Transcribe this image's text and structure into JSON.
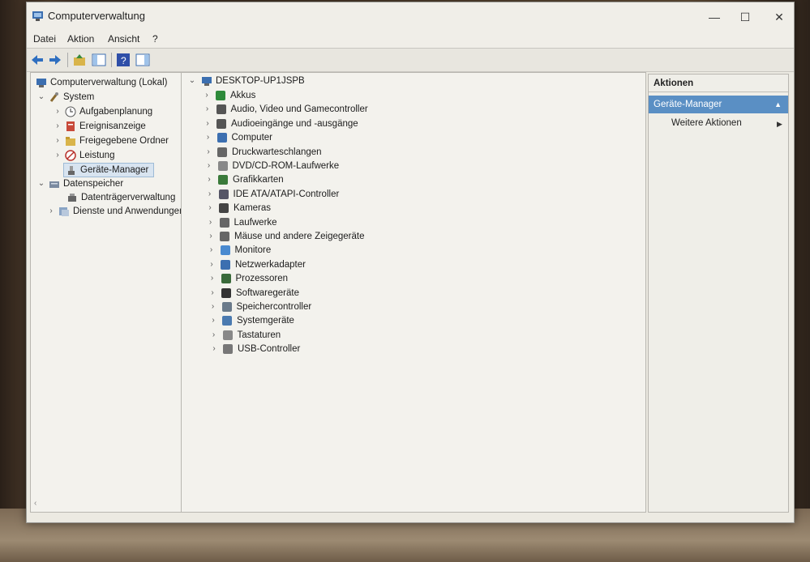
{
  "window": {
    "title": "Computerverwaltung",
    "controls": {
      "minimize": "—",
      "maximize": "☐",
      "close": "✕"
    }
  },
  "menu": [
    "Datei",
    "Aktion",
    "Ansicht",
    "?"
  ],
  "left_tree": {
    "root": "Computerverwaltung (Lokal)",
    "system": "System",
    "system_items": [
      "Aufgabenplanung",
      "Ereignisanzeige",
      "Freigegebene Ordner",
      "Leistung",
      "Geräte-Manager"
    ],
    "storage": "Datenspeicher",
    "storage_items": [
      "Datenträgerverwaltung"
    ],
    "services": "Dienste und Anwendungen"
  },
  "device_tree": {
    "root": "DESKTOP-UP1JSPB",
    "items": [
      "Akkus",
      "Audio, Video und Gamecontroller",
      "Audioeingänge und -ausgänge",
      "Computer",
      "Druckwarteschlangen",
      "DVD/CD-ROM-Laufwerke",
      "Grafikkarten",
      "IDE ATA/ATAPI-Controller",
      "Kameras",
      "Laufwerke",
      "Mäuse und andere Zeigegeräte",
      "Monitore",
      "Netzwerkadapter",
      "Prozessoren",
      "Softwaregeräte",
      "Speichercontroller",
      "Systemgeräte",
      "Tastaturen",
      "USB-Controller"
    ]
  },
  "actions": {
    "header": "Aktionen",
    "selected": "Geräte-Manager",
    "more": "Weitere Aktionen"
  },
  "colors": {
    "selection": "#5a8fc4",
    "window": "#eceae2"
  }
}
